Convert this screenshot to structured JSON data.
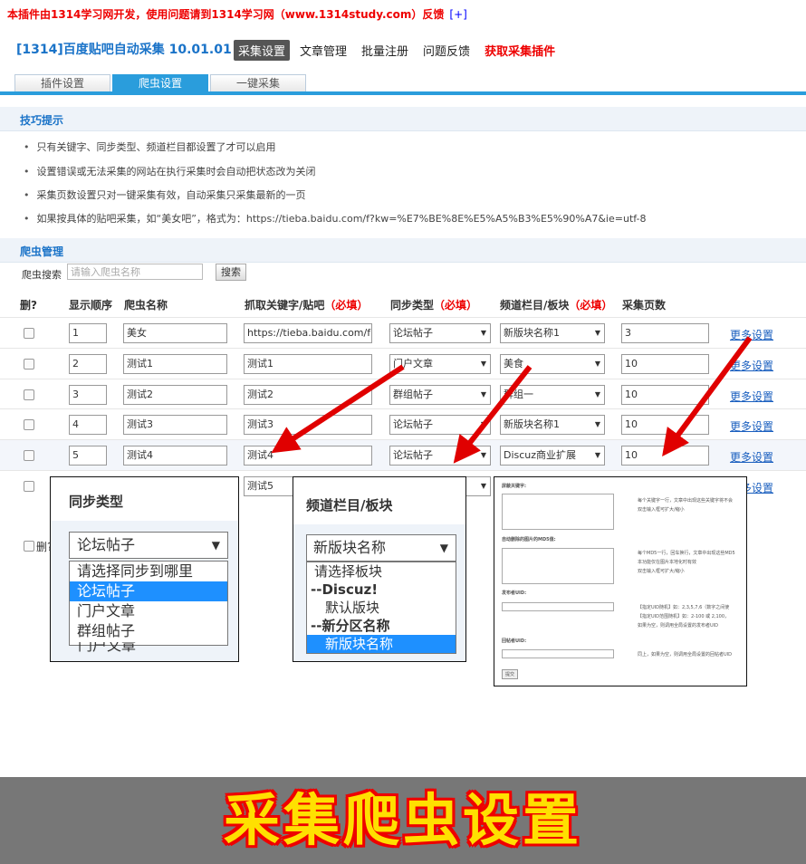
{
  "notice": {
    "text": "本插件由1314学习网开发，使用问题请到1314学习网（www.1314study.com）反馈",
    "plus": "[+]"
  },
  "header": {
    "title": "[1314]百度贴吧自动采集 10.01.01",
    "nav": [
      "采集设置",
      "文章管理",
      "批量注册",
      "问题反馈",
      "获取采集插件"
    ]
  },
  "tabs": [
    "插件设置",
    "爬虫设置",
    "一键采集"
  ],
  "tips": {
    "title": "技巧提示",
    "items": [
      "只有关键字、同步类型、频道栏目都设置了才可以启用",
      "设置错误或无法采集的网站在执行采集时会自动把状态改为关闭",
      "采集页数设置只对一键采集有效，自动采集只采集最新的一页",
      "如果按具体的贴吧采集，如“美女吧”，格式为：https://tieba.baidu.com/f?kw=%E7%BE%8E%E5%A5%B3%E5%90%A7&ie=utf-8"
    ]
  },
  "crawler": {
    "title": "爬虫管理",
    "search_label": "爬虫搜索",
    "search_placeholder": "请输入爬虫名称",
    "search_button": "搜索"
  },
  "columns": {
    "del": "删?",
    "order": "显示顺序",
    "name": "爬虫名称",
    "keyword": "抓取关键字/贴吧",
    "sync": "同步类型",
    "channel": "频道栏目/板块",
    "pages": "采集页数",
    "required": "（必填）"
  },
  "rows": [
    {
      "order": "1",
      "name": "美女",
      "keyword": "https://tieba.baidu.com/f",
      "sync": "论坛帖子",
      "channel": "新版块名称1",
      "pages": "3",
      "more": "更多设置"
    },
    {
      "order": "2",
      "name": "测试1",
      "keyword": "测试1",
      "sync": "门户文章",
      "channel": "美食",
      "pages": "10",
      "more": "更多设置"
    },
    {
      "order": "3",
      "name": "测试2",
      "keyword": "测试2",
      "sync": "群组帖子",
      "channel": "群组一",
      "pages": "10",
      "more": "更多设置"
    },
    {
      "order": "4",
      "name": "测试3",
      "keyword": "测试3",
      "sync": "论坛帖子",
      "channel": "新版块名称1",
      "pages": "10",
      "more": "更多设置"
    },
    {
      "order": "5",
      "name": "测试4",
      "keyword": "测试4",
      "sync": "论坛帖子",
      "channel": "Discuz商业扩展",
      "pages": "10",
      "more": "更多设置"
    },
    {
      "order": "",
      "name": "",
      "keyword": "测试5",
      "sync": "",
      "channel": "",
      "pages": "",
      "more": "更多设置"
    }
  ],
  "bottom_del": "删?",
  "popup_sync": {
    "title": "同步类型",
    "selected": "论坛帖子",
    "options": [
      "请选择同步到哪里",
      "论坛帖子",
      "门户文章",
      "群组帖子"
    ],
    "highlight": 1,
    "trailing": "门户文章"
  },
  "popup_channel": {
    "title": "频道栏目/板块",
    "selected": "新版块名称",
    "options": [
      "请选择板块",
      "--Discuz!",
      "默认版块",
      "--新分区名称",
      "新版块名称"
    ],
    "highlight": 4
  },
  "popup_more": {
    "labels": [
      "屏蔽关键字:",
      "自动删除的图片的MD5值:",
      "发布者UID:",
      "回帖者UID:"
    ],
    "notes": [
      "每个关键字一行，文章中出现这些关键字将不会",
      "双击输入框可扩大/缩小",
      "每个MD5一行，回车换行，文章中出现这些MD5",
      "本功能仅在图片本地化时有效",
      "双击输入框可扩大/缩小",
      "【指定UID随机】如：2,3,5,7,6（数字之间使",
      "【指定UID范围随机】如：2-100 或 2,100，",
      "如果为空，则调用全局设置的发布者UID",
      "同上，如果为空，则调用全局设置的回帖者UID"
    ],
    "submit": "提交"
  },
  "banner": "采集爬虫设置",
  "colors": {
    "accent": "#2a9ddc",
    "required": "#e00000",
    "banner_text": "#ffe000",
    "arrow": "#e00000"
  }
}
